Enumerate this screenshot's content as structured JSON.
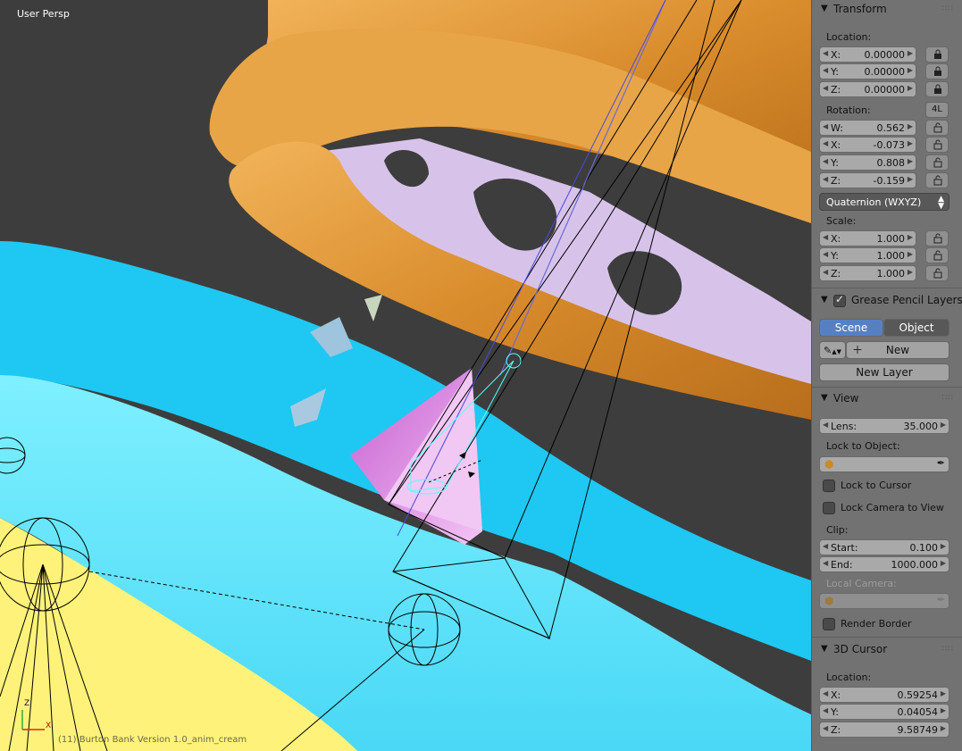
{
  "viewport": {
    "view_label": "User Persp",
    "status_text": "(11) Burton Bank Version 1.0_anim_cream",
    "axis_x": "X",
    "axis_z": "Z"
  },
  "transform": {
    "title": "Transform",
    "location_label": "Location:",
    "location": [
      {
        "axis": "X:",
        "value": "0.00000"
      },
      {
        "axis": "Y:",
        "value": "0.00000"
      },
      {
        "axis": "Z:",
        "value": "0.00000"
      }
    ],
    "rotation_label": "Rotation:",
    "rotation_lock_4l": "4L",
    "rotation": [
      {
        "axis": "W:",
        "value": "0.562"
      },
      {
        "axis": "X:",
        "value": "-0.073"
      },
      {
        "axis": "Y:",
        "value": "0.808"
      },
      {
        "axis": "Z:",
        "value": "-0.159"
      }
    ],
    "rotation_mode": "Quaternion (WXYZ)",
    "scale_label": "Scale:",
    "scale": [
      {
        "axis": "X:",
        "value": "1.000"
      },
      {
        "axis": "Y:",
        "value": "1.000"
      },
      {
        "axis": "Z:",
        "value": "1.000"
      }
    ]
  },
  "grease_pencil": {
    "title": "Grease Pencil Layers",
    "enabled": true,
    "tab_scene": "Scene",
    "tab_object": "Object",
    "active_tab": "Scene",
    "new_label": "New",
    "new_layer_label": "New Layer"
  },
  "view": {
    "title": "View",
    "lens_label": "Lens:",
    "lens_value": "35.000",
    "lock_to_object_label": "Lock to Object:",
    "lock_to_cursor_label": "Lock to Cursor",
    "lock_camera_label": "Lock Camera to View",
    "clip_label": "Clip:",
    "clip_start_label": "Start:",
    "clip_start_value": "0.100",
    "clip_end_label": "End:",
    "clip_end_value": "1000.000",
    "local_camera_label": "Local Camera:",
    "render_border_label": "Render Border"
  },
  "cursor": {
    "title": "3D Cursor",
    "location_label": "Location:",
    "location": [
      {
        "axis": "X:",
        "value": "0.59254"
      },
      {
        "axis": "Y:",
        "value": "0.04054"
      },
      {
        "axis": "Z:",
        "value": "9.58749"
      }
    ]
  },
  "colors": {
    "viewport_bg": "#3d3d3d",
    "panel_bg": "#727272",
    "accent_blue": "#5680c2",
    "gold": "#e09a3a",
    "cyan": "#4fe0ff",
    "pink": "#e9a6ee",
    "yellow": "#fff27a"
  }
}
